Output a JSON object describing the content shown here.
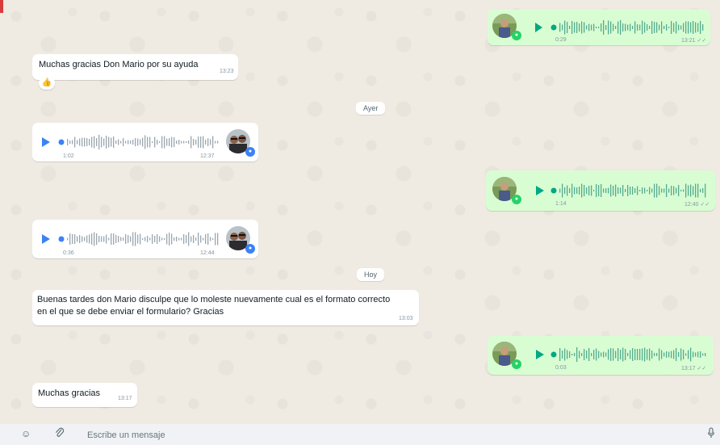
{
  "messages": {
    "m1": {
      "direction": "out",
      "type": "voice",
      "duration": "0:29",
      "time": "13:21",
      "ticks": "✓✓",
      "mic_color": "#25d366",
      "avatar": "man-photo"
    },
    "m2": {
      "direction": "in",
      "type": "text",
      "text": "Muchas gracias Don Mario por su ayuda",
      "time": "13:23",
      "reaction": "👍"
    },
    "date1": "Ayer",
    "m3": {
      "direction": "in",
      "type": "voice",
      "duration": "1:02",
      "time": "12:37",
      "mic_color": "#3b82f6",
      "avatar": "couple-photo"
    },
    "m4": {
      "direction": "out",
      "type": "voice",
      "duration": "1:14",
      "time": "12:40",
      "ticks": "✓✓",
      "mic_color": "#25d366",
      "avatar": "man-photo"
    },
    "m5": {
      "direction": "in",
      "type": "voice",
      "duration": "0:36",
      "time": "12:44",
      "mic_color": "#3b82f6",
      "avatar": "couple-photo"
    },
    "date2": "Hoy",
    "m6": {
      "direction": "in",
      "type": "text",
      "line1": "Buenas tardes don Mario disculpe que lo moleste nuevamente cual es el formato correcto",
      "line2": "en el que se debe enviar el formulario? Gracias",
      "time": "13:03"
    },
    "m7": {
      "direction": "out",
      "type": "voice",
      "duration": "0:03",
      "time": "13:17",
      "ticks": "✓✓",
      "mic_color": "#25d366",
      "avatar": "man-photo"
    },
    "m8": {
      "direction": "in",
      "type": "text",
      "text": "Muchas gracias",
      "time": "13:17"
    }
  },
  "composer": {
    "placeholder": "Escribe un mensaje",
    "emoji_icon": "smiley-icon",
    "attach_icon": "paperclip-icon",
    "mic_icon": "microphone-icon"
  },
  "colors": {
    "play_out": "#00a884",
    "play_in": "#3b82f6",
    "wave_out": "#54ab8f",
    "wave_in": "#9aa6ae",
    "dot_out": "#00a884",
    "dot_in": "#3b82f6"
  }
}
